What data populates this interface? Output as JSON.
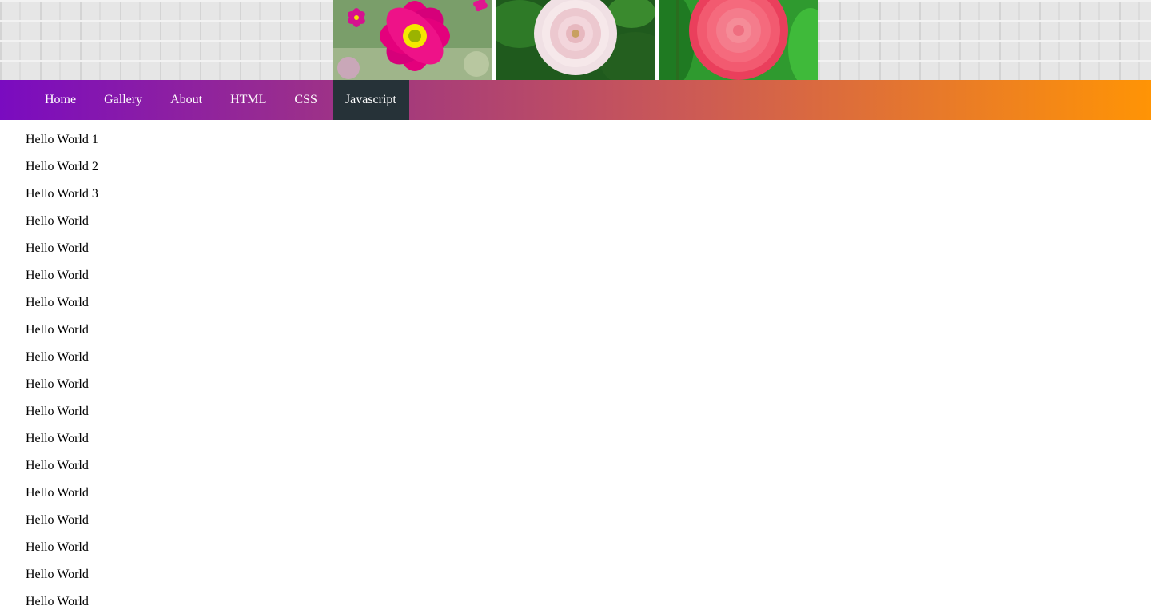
{
  "banner": {
    "photos": [
      {
        "icon": "pink-cosmos-flower-photo",
        "color": "#e6007e"
      },
      {
        "icon": "white-dahlia-flower-photo",
        "color": "#f2d6dc"
      },
      {
        "icon": "pink-dahlia-flower-photo",
        "color": "#f2546a"
      }
    ]
  },
  "nav": {
    "items": [
      {
        "label": "Home"
      },
      {
        "label": "Gallery"
      },
      {
        "label": "About"
      },
      {
        "label": "HTML"
      },
      {
        "label": "CSS"
      },
      {
        "label": "Javascript",
        "active": true
      }
    ],
    "gradient_start": "#7a0bc0",
    "gradient_end": "#ff9405",
    "active_bg": "#263238"
  },
  "content": {
    "items": [
      "Hello World 1",
      "Hello World 2",
      "Hello World 3",
      "Hello World",
      "Hello World",
      "Hello World",
      "Hello World",
      "Hello World",
      "Hello World",
      "Hello World",
      "Hello World",
      "Hello World",
      "Hello World",
      "Hello World",
      "Hello World",
      "Hello World",
      "Hello World",
      "Hello World"
    ]
  }
}
